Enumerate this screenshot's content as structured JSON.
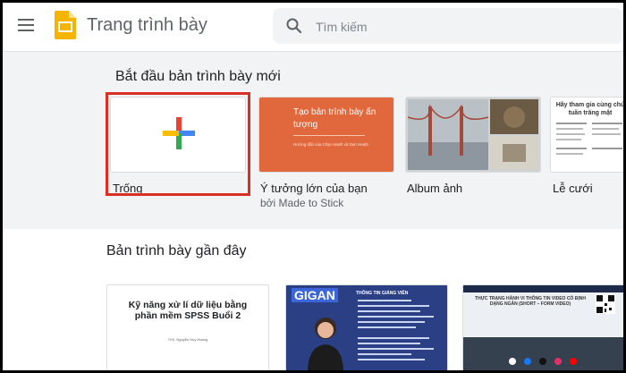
{
  "header": {
    "app_title": "Trang trình bày",
    "search_placeholder": "Tìm kiếm"
  },
  "templates": {
    "section_title": "Bắt đầu bản trình bày mới",
    "items": [
      {
        "label": "Trống"
      },
      {
        "label": "Ý tưởng lớn của bạn",
        "sub": "bởi Made to Stick",
        "thumb_title": "Tạo bản trình bày ấn tượng",
        "thumb_author": "Hướng dẫn của Chip Heath và Dan Heath"
      },
      {
        "label": "Album ảnh"
      },
      {
        "label": "Lễ cưới",
        "thumb_title": "Hãy tham gia cùng chú tuần trăng mật"
      }
    ]
  },
  "recent": {
    "section_title": "Bản trình bày gần đây",
    "docs": [
      {
        "title": "Kỹ năng xử lí dữ liệu bằng phần mềm SPSS Buổi 2",
        "author": "ThS. Nguyễn Huy Hoàng"
      },
      {
        "logo": "GIGAN",
        "info_title": "THÔNG TIN GIẢNG VIÊN"
      },
      {
        "title": "THỰC TRẠNG HÀNH VI THÔNG TIN VIDEO CÓ ĐỊNH DẠNG NGẮN (SHORT – FORM VIDEO)"
      }
    ]
  },
  "colors": {
    "accent_red": "#d93025",
    "logo_yellow": "#f4b400",
    "idea_orange": "#e1683c",
    "doc_blue": "#2a3f84"
  }
}
